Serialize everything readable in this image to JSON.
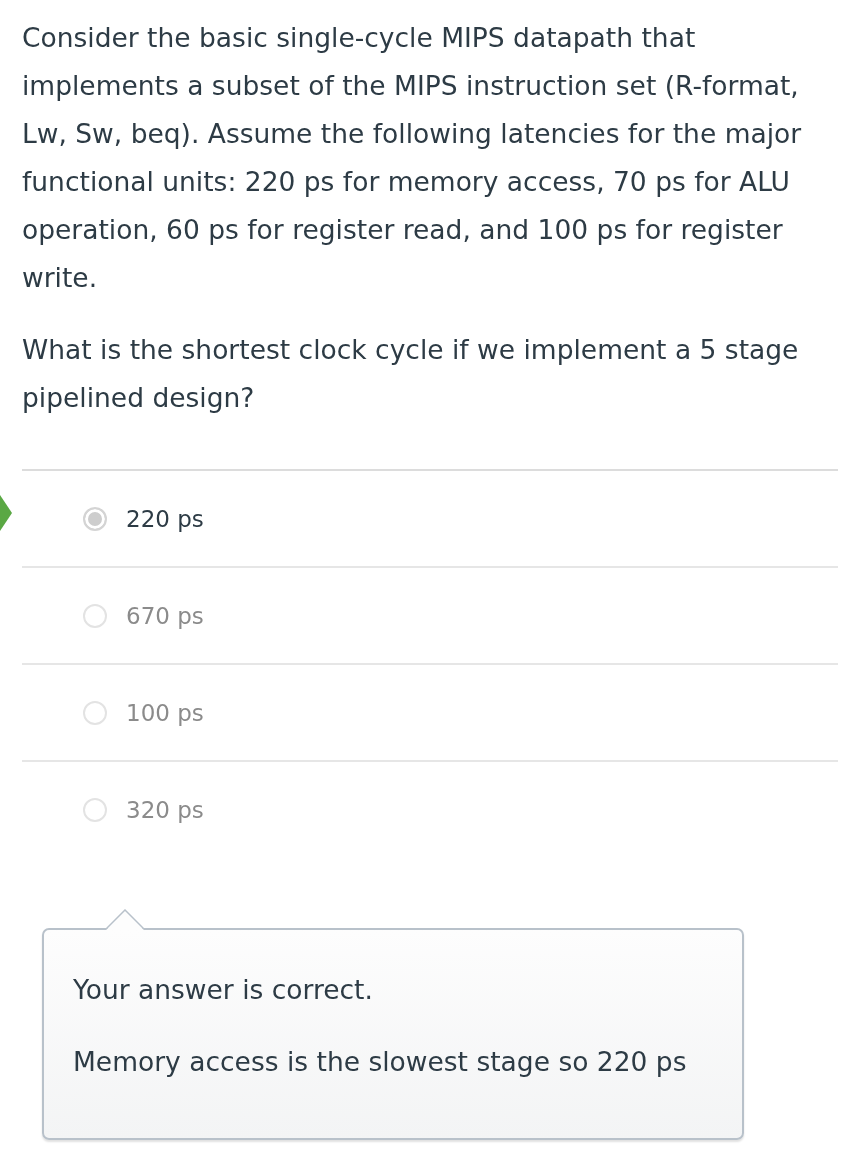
{
  "question": {
    "paragraphs": [
      "Consider the basic single-cycle MIPS datapath that implements a subset of the MIPS instruction set (R-format, Lw, Sw, beq). Assume the following latencies for the major functional units: 220 ps for memory access, 70 ps for ALU operation, 60 ps for register read, and 100 ps for register write.",
      "What is the shortest clock cycle if we implement a 5 stage pipelined design?"
    ]
  },
  "answers": [
    {
      "label": "220 ps",
      "selected": true,
      "correct": true
    },
    {
      "label": "670 ps",
      "selected": false,
      "correct": false
    },
    {
      "label": "100 ps",
      "selected": false,
      "correct": false
    },
    {
      "label": "320 ps",
      "selected": false,
      "correct": false
    }
  ],
  "feedback": {
    "lines": [
      "Your answer is correct.",
      "Memory access is the slowest stage so 220 ps"
    ]
  }
}
